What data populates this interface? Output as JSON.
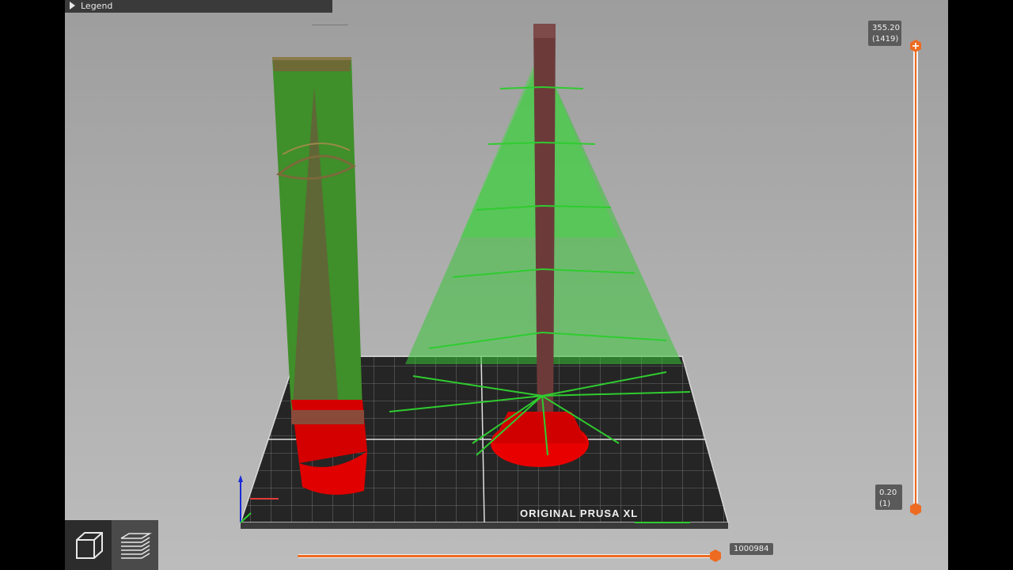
{
  "legend": {
    "label": "Legend"
  },
  "printer_bed": {
    "label": "ORIGINAL PRUSA XL"
  },
  "layer_slider": {
    "top_height": "355.20",
    "top_layer": "(1419)",
    "bottom_height": "0.20",
    "bottom_layer": "(1)"
  },
  "move_slider": {
    "value": "1000984"
  },
  "view_buttons": [
    {
      "name": "3d-view",
      "active": false
    },
    {
      "name": "preview",
      "active": true
    }
  ],
  "colors": {
    "accent": "#ed6b21",
    "support": "#ff0000",
    "infill_green": "#2fcc2f",
    "wall_brown": "#6e3a3a",
    "bed": "#2a2a2a"
  },
  "icons": [
    "legend-expand-icon",
    "plus-icon",
    "lock-icon",
    "cog-icon",
    "cube-icon",
    "layers-icon",
    "axis-icon"
  ]
}
